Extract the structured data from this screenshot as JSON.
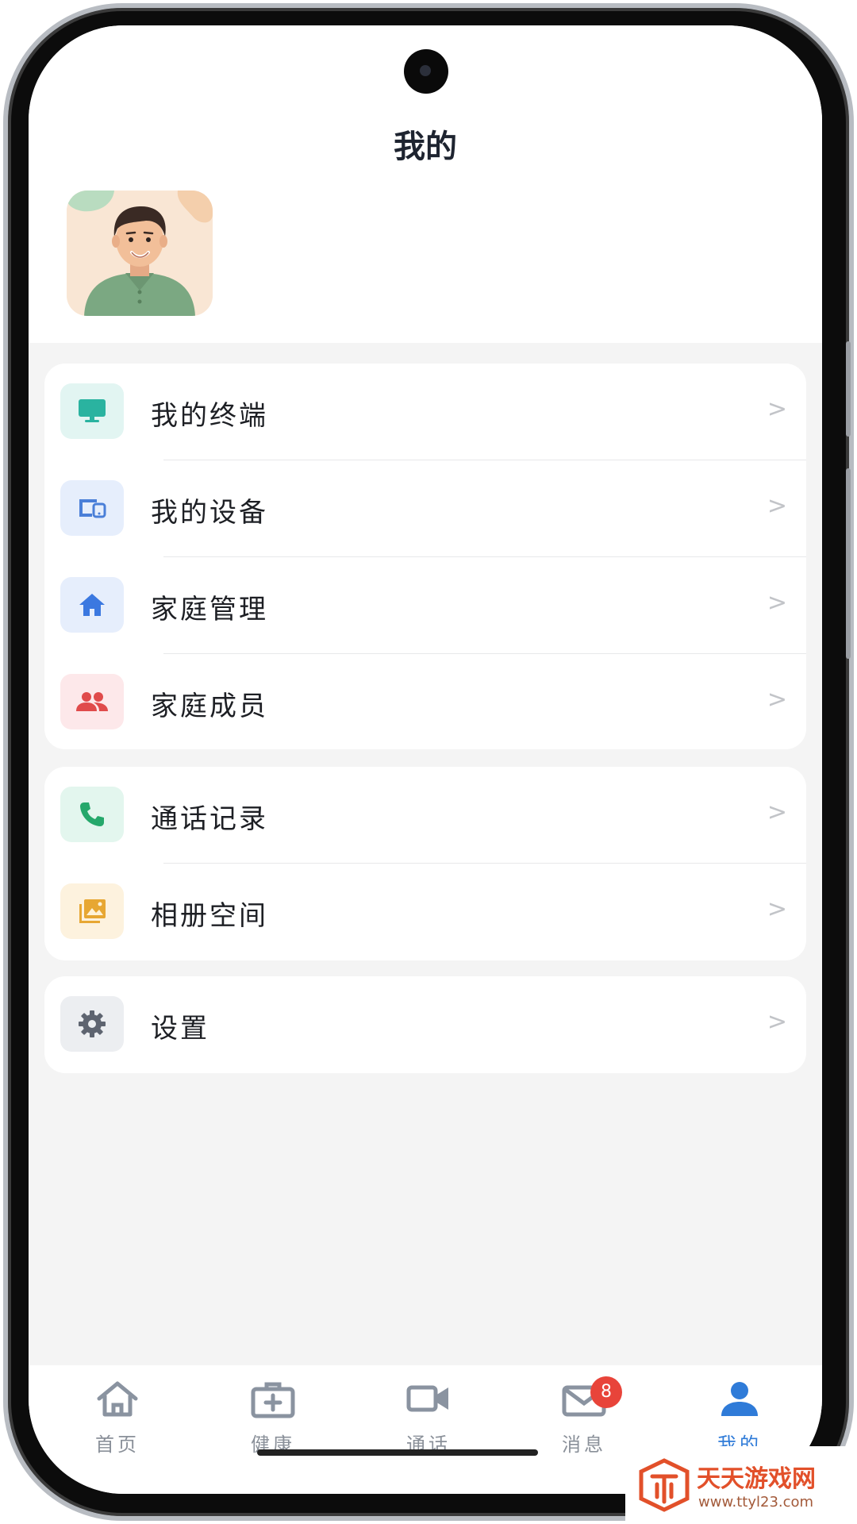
{
  "page": {
    "title": "我的"
  },
  "menu_groups": [
    [
      {
        "label": "我的终端",
        "icon": "monitor-icon",
        "chevron": ">"
      },
      {
        "label": "我的设备",
        "icon": "devices-icon",
        "chevron": ">"
      },
      {
        "label": "家庭管理",
        "icon": "home-icon",
        "chevron": ">"
      },
      {
        "label": "家庭成员",
        "icon": "people-icon",
        "chevron": ">"
      }
    ],
    [
      {
        "label": "通话记录",
        "icon": "phone-icon",
        "chevron": ">"
      },
      {
        "label": "相册空间",
        "icon": "photos-icon",
        "chevron": ">"
      }
    ],
    [
      {
        "label": "设置",
        "icon": "gear-icon",
        "chevron": ">"
      }
    ]
  ],
  "nav": {
    "items": [
      {
        "label": "首页",
        "icon": "home-outline-icon"
      },
      {
        "label": "健康",
        "icon": "medkit-icon"
      },
      {
        "label": "通话",
        "icon": "video-icon"
      },
      {
        "label": "消息",
        "icon": "mail-icon",
        "badge": "8"
      },
      {
        "label": "我的",
        "icon": "person-icon",
        "active": true
      }
    ]
  },
  "watermark": {
    "title": "天天游戏网",
    "url": "www.ttyl23.com"
  },
  "colors": {
    "accent": "#2f7bd8",
    "badge": "#e8443a",
    "teal": "#2ab3a0",
    "blue": "#4a7fd8",
    "red": "#e04b4b",
    "green": "#25a86b",
    "amber": "#e7a733",
    "gray": "#6e7480"
  }
}
